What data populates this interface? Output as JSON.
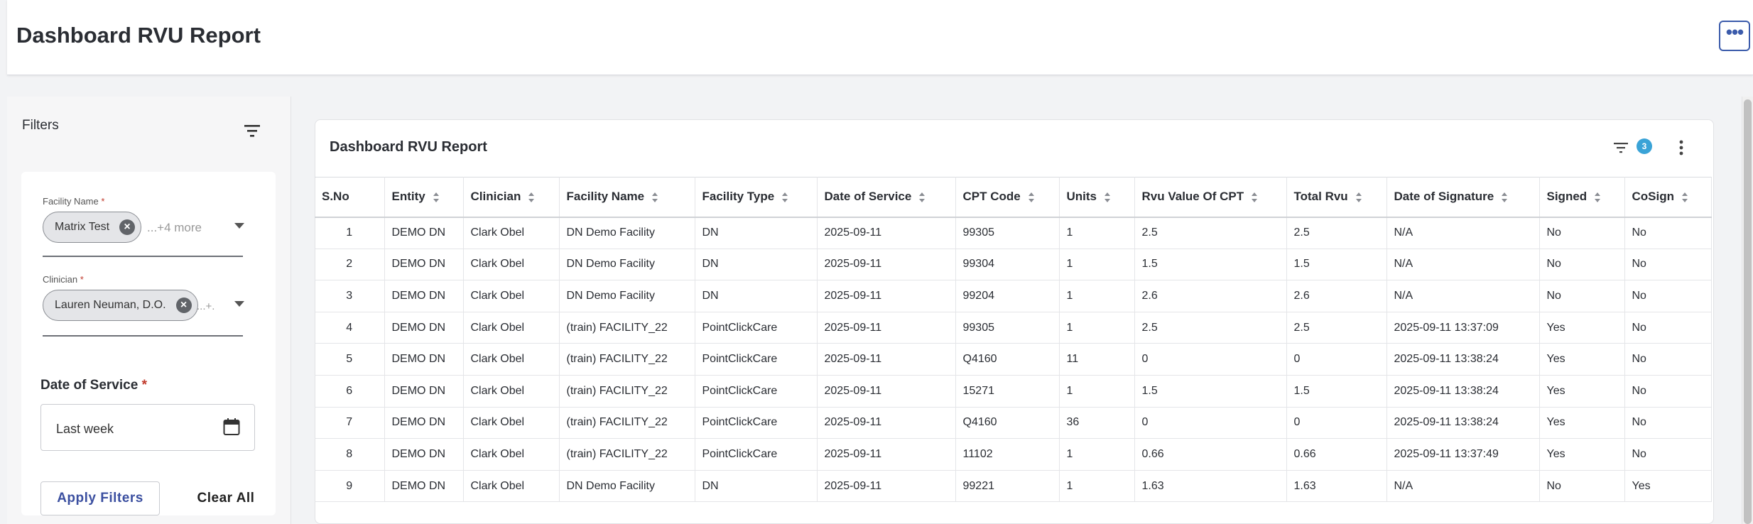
{
  "header": {
    "title": "Dashboard RVU Report",
    "more_label": "•••"
  },
  "filters": {
    "label": "Filters",
    "facility": {
      "label": "Facility Name",
      "required": "*",
      "chip": "Matrix Test",
      "more": "...+4 more"
    },
    "clinician": {
      "label": "Clinician",
      "required": "*",
      "chip": "Lauren Neuman, D.O.",
      "more": "...+."
    },
    "date_of_service": {
      "label": "Date of Service",
      "required": "*",
      "value": "Last week"
    },
    "apply_label": "Apply Filters",
    "clear_label": "Clear All"
  },
  "report": {
    "title": "Dashboard RVU Report",
    "active_filter_count": "3",
    "columns": [
      "S.No",
      "Entity",
      "Clinician",
      "Facility Name",
      "Facility Type",
      "Date of Service",
      "CPT Code",
      "Units",
      "Rvu Value Of CPT",
      "Total Rvu",
      "Date of Signature",
      "Signed",
      "CoSign"
    ],
    "rows": [
      [
        "1",
        "DEMO DN",
        "Clark Obel",
        "DN Demo Facility",
        "DN",
        "2025-09-11",
        "99305",
        "1",
        "2.5",
        "2.5",
        "N/A",
        "No",
        "No"
      ],
      [
        "2",
        "DEMO DN",
        "Clark Obel",
        "DN Demo Facility",
        "DN",
        "2025-09-11",
        "99304",
        "1",
        "1.5",
        "1.5",
        "N/A",
        "No",
        "No"
      ],
      [
        "3",
        "DEMO DN",
        "Clark Obel",
        "DN Demo Facility",
        "DN",
        "2025-09-11",
        "99204",
        "1",
        "2.6",
        "2.6",
        "N/A",
        "No",
        "No"
      ],
      [
        "4",
        "DEMO DN",
        "Clark Obel",
        "(train) FACILITY_22",
        "PointClickCare",
        "2025-09-11",
        "99305",
        "1",
        "2.5",
        "2.5",
        "2025-09-11 13:37:09",
        "Yes",
        "No"
      ],
      [
        "5",
        "DEMO DN",
        "Clark Obel",
        "(train) FACILITY_22",
        "PointClickCare",
        "2025-09-11",
        "Q4160",
        "11",
        "0",
        "0",
        "2025-09-11 13:38:24",
        "Yes",
        "No"
      ],
      [
        "6",
        "DEMO DN",
        "Clark Obel",
        "(train) FACILITY_22",
        "PointClickCare",
        "2025-09-11",
        "15271",
        "1",
        "1.5",
        "1.5",
        "2025-09-11 13:38:24",
        "Yes",
        "No"
      ],
      [
        "7",
        "DEMO DN",
        "Clark Obel",
        "(train) FACILITY_22",
        "PointClickCare",
        "2025-09-11",
        "Q4160",
        "36",
        "0",
        "0",
        "2025-09-11 13:38:24",
        "Yes",
        "No"
      ],
      [
        "8",
        "DEMO DN",
        "Clark Obel",
        "(train) FACILITY_22",
        "PointClickCare",
        "2025-09-11",
        "11102",
        "1",
        "0.66",
        "0.66",
        "2025-09-11 13:37:49",
        "Yes",
        "No"
      ],
      [
        "9",
        "DEMO DN",
        "Clark Obel",
        "DN Demo Facility",
        "DN",
        "2025-09-11",
        "99221",
        "1",
        "1.63",
        "1.63",
        "N/A",
        "No",
        "Yes"
      ]
    ]
  },
  "colors": {
    "accent": "#3b5bab",
    "badge": "#3aa3d7",
    "required": "#c0392b"
  }
}
